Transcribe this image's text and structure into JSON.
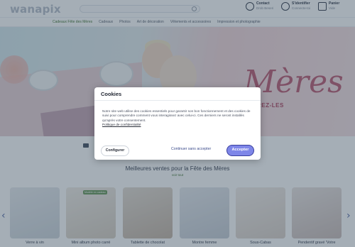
{
  "brand": {
    "logo_text": "wanapix"
  },
  "search": {
    "placeholder": ""
  },
  "header_links": [
    {
      "title": "Contact",
      "subtitle": "Drob Beseri"
    },
    {
      "title": "S'identifier",
      "subtitle": "Connecte-toi"
    },
    {
      "title": "Panier",
      "subtitle": "Vide"
    }
  ],
  "nav": {
    "items": [
      "Cadeaux Fête des Mères",
      "Cadeaux",
      "Photos",
      "Art de décoration",
      "Vêtements et accessoires",
      "Impression et photographie"
    ]
  },
  "hero": {
    "title": "Mères",
    "cta": "COUVREZ-LES"
  },
  "best_sellers": {
    "title": "Meilleures ventes pour la Fête des Mères",
    "link": "voir tout"
  },
  "products": [
    {
      "name": "Verre à vin",
      "badge": ""
    },
    {
      "name": "Mini album photo carré",
      "badge": "Modèle en cadeau"
    },
    {
      "name": "Tablette de chocolat",
      "badge": ""
    },
    {
      "name": "Montre femme",
      "badge": ""
    },
    {
      "name": "Sous-Cabas",
      "badge": ""
    },
    {
      "name": "Pendentif gravé 'Votre",
      "badge": ""
    }
  ],
  "cookie_modal": {
    "title": "Cookies",
    "body": "Notre site web utilise des cookies essentiels pour garantir son bon fonctionnement et des cookies de suivi pour comprendre comment vous interagissez avec celui-ci. Ces derniers ne seront installés qu'après votre consentement.",
    "policy_link": "Politique de confidentialité",
    "configure_label": "Configurer",
    "continue_label": "Continuer sans accepter",
    "accept_label": "Accepter"
  },
  "colors": {
    "overlay": "#283e52",
    "accept_button": "#7e86e8",
    "hero_title": "#b44a64",
    "featured_nav": "#4a7a3a"
  }
}
